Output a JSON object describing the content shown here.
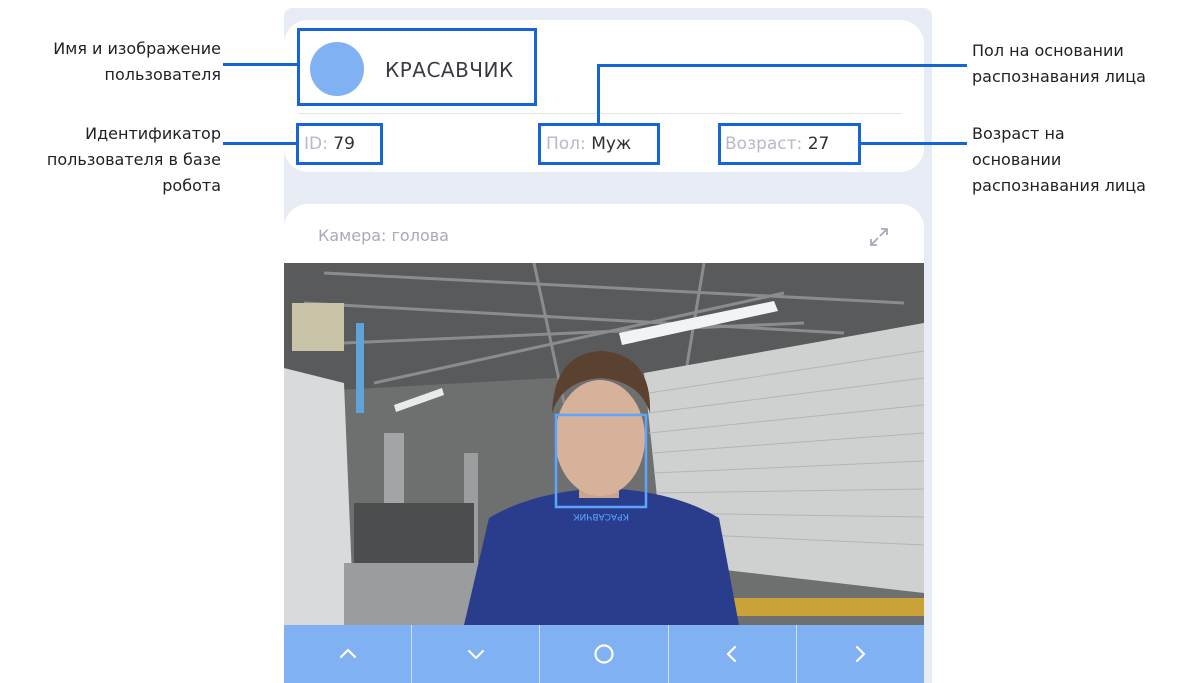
{
  "profile": {
    "name": "КРАСАВЧИК",
    "id_label": "ID:",
    "id_value": "79",
    "gender_label": "Пол:",
    "gender_value": "Муж",
    "age_label": "Возраст:",
    "age_value": "27"
  },
  "camera": {
    "title": "Камера: голова",
    "face_tag": "КРАСАВЧИК"
  },
  "controls": [
    {
      "icon": "chevron-up-icon"
    },
    {
      "icon": "chevron-down-icon"
    },
    {
      "icon": "circle-icon"
    },
    {
      "icon": "chevron-left-icon"
    },
    {
      "icon": "chevron-right-icon"
    }
  ],
  "annotations": {
    "name_avatar": [
      "Имя и изображение",
      "пользователя"
    ],
    "user_id": [
      "Идентификатор",
      "пользователя в базе",
      "робота"
    ],
    "gender": [
      "Пол на основании",
      "распознавания лица"
    ],
    "age": [
      "Возраст на",
      "основании",
      "распознавания лица"
    ]
  },
  "colors": {
    "accent": "#80b1f2",
    "highlight": "#1565d8",
    "background": "#e6ebf4"
  }
}
